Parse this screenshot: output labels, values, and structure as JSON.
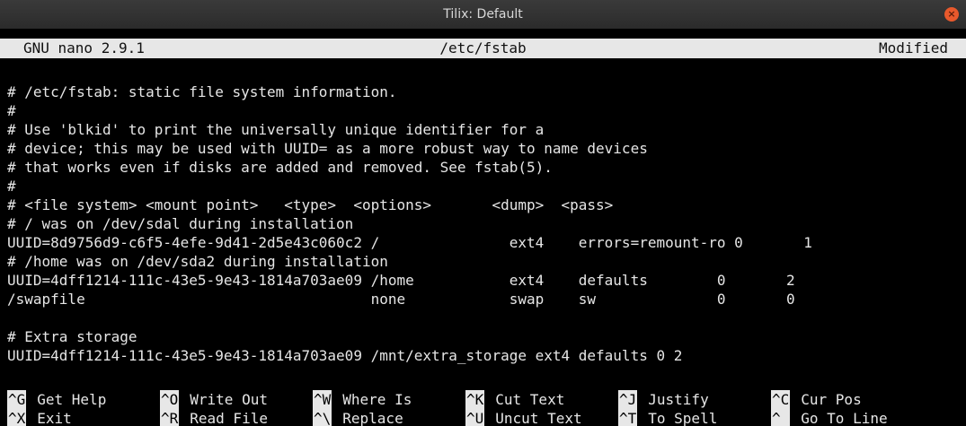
{
  "window": {
    "title": "Tilix: Default",
    "close_icon": "close-icon"
  },
  "nano": {
    "version": "GNU nano 2.9.1",
    "filename": "/etc/fstab",
    "status": "Modified"
  },
  "file_lines": [
    "# /etc/fstab: static file system information.",
    "#",
    "# Use 'blkid' to print the universally unique identifier for a",
    "# device; this may be used with UUID= as a more robust way to name devices",
    "# that works even if disks are added and removed. See fstab(5).",
    "#",
    "# <file system> <mount point>   <type>  <options>       <dump>  <pass>",
    "# / was on /dev/sdal during installation",
    "UUID=8d9756d9-c6f5-4efe-9d41-2d5e43c060c2 /               ext4    errors=remount-ro 0       1",
    "# /home was on /dev/sda2 during installation",
    "UUID=4dff1214-111c-43e5-9e43-1814a703ae09 /home           ext4    defaults        0       2",
    "/swapfile                                 none            swap    sw              0       0",
    "",
    "# Extra storage",
    "UUID=4dff1214-111c-43e5-9e43-1814a703ae09 /mnt/extra_storage ext4 defaults 0 2"
  ],
  "shortcuts": {
    "row1": [
      {
        "key": "^G",
        "label": "Get Help"
      },
      {
        "key": "^O",
        "label": "Write Out"
      },
      {
        "key": "^W",
        "label": "Where Is"
      },
      {
        "key": "^K",
        "label": "Cut Text"
      },
      {
        "key": "^J",
        "label": "Justify"
      },
      {
        "key": "^C",
        "label": "Cur Pos"
      }
    ],
    "row2": [
      {
        "key": "^X",
        "label": "Exit"
      },
      {
        "key": "^R",
        "label": "Read File"
      },
      {
        "key": "^\\",
        "label": "Replace"
      },
      {
        "key": "^U",
        "label": "Uncut Text"
      },
      {
        "key": "^T",
        "label": "To Spell"
      },
      {
        "key": "^_",
        "label": "Go To Line"
      }
    ]
  },
  "colors": {
    "titlebar": "#2f2f2f",
    "close_button": "#e8592c",
    "terminal_bg": "#000000",
    "header_bg": "#e7e7e7"
  }
}
